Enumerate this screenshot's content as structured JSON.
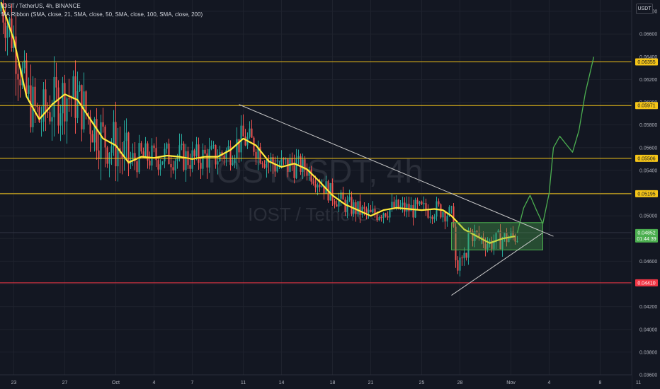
{
  "header": {
    "symbol_line": "IOST / TetherUS, 4h, BINANCE",
    "indicator_line": "MA Ribbon (SMA, close, 21, SMA, close, 50, SMA, close, 100, SMA, close, 200)"
  },
  "currency_button": "USDT",
  "watermark": {
    "big": "IOSTUSDT, 4h",
    "small": "IOST / TetherUS"
  },
  "colors": {
    "background": "#131722",
    "up": "#26a69a",
    "down": "#ef5350",
    "ma21": "#ffeb3b",
    "level_line": "#f5c518",
    "support_line": "#f23645",
    "projection": "#4caf50",
    "trendline": "#c9c9c9"
  },
  "chart_data": {
    "type": "candlestick",
    "title": "IOST / TetherUS, 4h, BINANCE",
    "y_axis": {
      "min": 0.036,
      "max": 0.069,
      "ticks": [
        "0.06800",
        "0.06600",
        "0.06400",
        "0.06200",
        "0.06000",
        "0.05800",
        "0.05600",
        "0.05400",
        "0.05200",
        "0.05000",
        "0.04800",
        "0.04600",
        "0.04400",
        "0.04200",
        "0.04000",
        "0.03800",
        "0.03600"
      ]
    },
    "x_axis": {
      "ticks": [
        {
          "label": "23",
          "i": 6
        },
        {
          "label": "27",
          "i": 30
        },
        {
          "label": "Oct",
          "i": 54
        },
        {
          "label": "4",
          "i": 72
        },
        {
          "label": "7",
          "i": 90
        },
        {
          "label": "11",
          "i": 114
        },
        {
          "label": "14",
          "i": 132
        },
        {
          "label": "18",
          "i": 156
        },
        {
          "label": "21",
          "i": 174
        },
        {
          "label": "25",
          "i": 198
        },
        {
          "label": "28",
          "i": 216
        },
        {
          "label": "Nov",
          "i": 240
        },
        {
          "label": "4",
          "i": 258
        },
        {
          "label": "8",
          "i": 282
        },
        {
          "label": "11",
          "i": 300
        }
      ]
    },
    "horizontal_levels": [
      {
        "value": 0.06355,
        "label": "0.06355",
        "color": "#f5c518"
      },
      {
        "value": 0.05971,
        "label": "0.05971",
        "color": "#f5c518"
      },
      {
        "value": 0.05506,
        "label": "0.05506",
        "color": "#f5c518"
      },
      {
        "value": 0.05195,
        "label": "0.05195",
        "color": "#f5c518"
      },
      {
        "value": 0.0441,
        "label": "0.04410",
        "color": "#f23645"
      }
    ],
    "current_price": {
      "value": 0.04852,
      "label": "0.04852",
      "countdown": "01:44:39"
    },
    "trendlines": [
      {
        "from": {
          "i": 112,
          "y": 0.0598
        },
        "to": {
          "i": 260,
          "y": 0.0482
        }
      },
      {
        "from": {
          "i": 212,
          "y": 0.043
        },
        "to": {
          "i": 255,
          "y": 0.0485
        }
      }
    ],
    "rectangle": {
      "i0": 212,
      "i1": 255,
      "y0": 0.047,
      "y1": 0.0494
    },
    "projection_path": [
      {
        "i": 243,
        "y": 0.0485
      },
      {
        "i": 246,
        "y": 0.0507
      },
      {
        "i": 249,
        "y": 0.0518
      },
      {
        "i": 252,
        "y": 0.0505
      },
      {
        "i": 255,
        "y": 0.0493
      },
      {
        "i": 258,
        "y": 0.052
      },
      {
        "i": 260,
        "y": 0.056
      },
      {
        "i": 263,
        "y": 0.057
      },
      {
        "i": 266,
        "y": 0.0563
      },
      {
        "i": 269,
        "y": 0.0556
      },
      {
        "i": 272,
        "y": 0.0575
      },
      {
        "i": 275,
        "y": 0.0608
      },
      {
        "i": 279,
        "y": 0.064
      }
    ],
    "ma21": [
      {
        "i": 0,
        "y": 0.0688
      },
      {
        "i": 6,
        "y": 0.0655
      },
      {
        "i": 12,
        "y": 0.0605
      },
      {
        "i": 18,
        "y": 0.0585
      },
      {
        "i": 24,
        "y": 0.0598
      },
      {
        "i": 30,
        "y": 0.0607
      },
      {
        "i": 36,
        "y": 0.0602
      },
      {
        "i": 42,
        "y": 0.0585
      },
      {
        "i": 48,
        "y": 0.0568
      },
      {
        "i": 54,
        "y": 0.0562
      },
      {
        "i": 60,
        "y": 0.0547
      },
      {
        "i": 66,
        "y": 0.0552
      },
      {
        "i": 72,
        "y": 0.0551
      },
      {
        "i": 78,
        "y": 0.0553
      },
      {
        "i": 84,
        "y": 0.0552
      },
      {
        "i": 90,
        "y": 0.055
      },
      {
        "i": 96,
        "y": 0.0552
      },
      {
        "i": 102,
        "y": 0.0552
      },
      {
        "i": 108,
        "y": 0.0558
      },
      {
        "i": 114,
        "y": 0.0568
      },
      {
        "i": 120,
        "y": 0.0562
      },
      {
        "i": 126,
        "y": 0.0548
      },
      {
        "i": 132,
        "y": 0.0543
      },
      {
        "i": 138,
        "y": 0.0546
      },
      {
        "i": 144,
        "y": 0.0541
      },
      {
        "i": 150,
        "y": 0.053
      },
      {
        "i": 156,
        "y": 0.0518
      },
      {
        "i": 162,
        "y": 0.051
      },
      {
        "i": 168,
        "y": 0.0505
      },
      {
        "i": 174,
        "y": 0.05
      },
      {
        "i": 180,
        "y": 0.0505
      },
      {
        "i": 186,
        "y": 0.0507
      },
      {
        "i": 192,
        "y": 0.0506
      },
      {
        "i": 198,
        "y": 0.0505
      },
      {
        "i": 204,
        "y": 0.0506
      },
      {
        "i": 208,
        "y": 0.0505
      },
      {
        "i": 212,
        "y": 0.05
      },
      {
        "i": 218,
        "y": 0.0488
      },
      {
        "i": 224,
        "y": 0.0482
      },
      {
        "i": 230,
        "y": 0.0476
      },
      {
        "i": 236,
        "y": 0.048
      },
      {
        "i": 242,
        "y": 0.0482
      }
    ],
    "candles": {
      "start": 0,
      "end": 243,
      "seed": 7,
      "note": "price path follows ma21 with noise"
    }
  }
}
